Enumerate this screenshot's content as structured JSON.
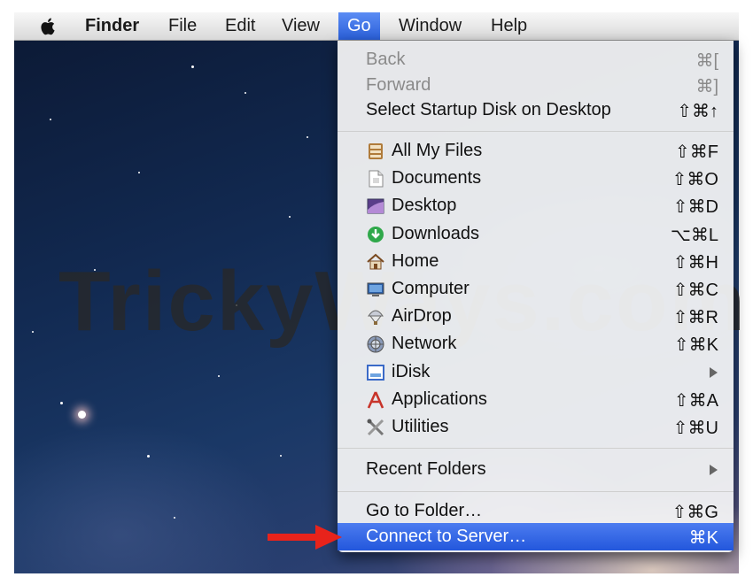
{
  "menubar": {
    "apple_icon": "apple-icon",
    "items": [
      {
        "label": "Finder"
      },
      {
        "label": "File"
      },
      {
        "label": "Edit"
      },
      {
        "label": "View"
      },
      {
        "label": "Go"
      },
      {
        "label": "Window"
      },
      {
        "label": "Help"
      }
    ]
  },
  "watermark": "TrickyWays.com",
  "go_menu": {
    "group1": [
      {
        "label": "Back",
        "shortcut": "⌘[",
        "enabled": false
      },
      {
        "label": "Forward",
        "shortcut": "⌘]",
        "enabled": false
      },
      {
        "label": "Select Startup Disk on Desktop",
        "shortcut": "⇧⌘↑",
        "enabled": true
      }
    ],
    "places": [
      {
        "label": "All My Files",
        "shortcut": "⇧⌘F",
        "icon": "all-my-files-icon"
      },
      {
        "label": "Documents",
        "shortcut": "⇧⌘O",
        "icon": "documents-icon"
      },
      {
        "label": "Desktop",
        "shortcut": "⇧⌘D",
        "icon": "desktop-icon"
      },
      {
        "label": "Downloads",
        "shortcut": "⌥⌘L",
        "icon": "downloads-icon"
      },
      {
        "label": "Home",
        "shortcut": "⇧⌘H",
        "icon": "home-icon"
      },
      {
        "label": "Computer",
        "shortcut": "⇧⌘C",
        "icon": "computer-icon"
      },
      {
        "label": "AirDrop",
        "shortcut": "⇧⌘R",
        "icon": "airdrop-icon"
      },
      {
        "label": "Network",
        "shortcut": "⇧⌘K",
        "icon": "network-icon"
      },
      {
        "label": "iDisk",
        "shortcut": "",
        "icon": "idisk-icon",
        "submenu": true
      },
      {
        "label": "Applications",
        "shortcut": "⇧⌘A",
        "icon": "applications-icon"
      },
      {
        "label": "Utilities",
        "shortcut": "⇧⌘U",
        "icon": "utilities-icon"
      }
    ],
    "recent_folders": {
      "label": "Recent Folders",
      "submenu": true
    },
    "go_to_folder": {
      "label": "Go to Folder…",
      "shortcut": "⇧⌘G"
    },
    "connect_to_server": {
      "label": "Connect to Server…",
      "shortcut": "⌘K",
      "highlighted": true
    }
  },
  "colors": {
    "highlight": "#2f63e0",
    "menubar": "#e6e6e6",
    "arrow": "#e8231b"
  }
}
